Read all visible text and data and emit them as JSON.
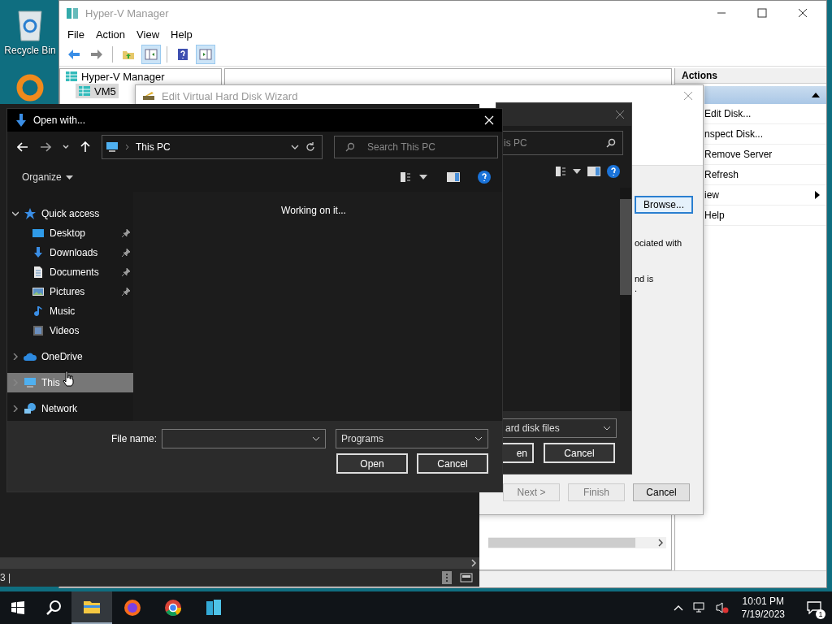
{
  "desktop": {
    "icons": [
      {
        "kind": "recycle",
        "label": "Recycle Bin"
      },
      {
        "kind": "ring"
      }
    ]
  },
  "hyperv": {
    "title": "Hyper-V Manager",
    "menu": [
      "File",
      "Action",
      "View",
      "Help"
    ],
    "toolbar": [
      {
        "kind": "back",
        "pressed": false
      },
      {
        "kind": "forward",
        "pressed": false
      },
      {
        "kind": "folder",
        "pressed": false
      },
      {
        "kind": "tree",
        "pressed": true
      },
      {
        "kind": "help",
        "pressed": false
      },
      {
        "kind": "pane",
        "pressed": true
      }
    ],
    "tree": [
      {
        "label": "Hyper-V Manager",
        "selected": false,
        "children": [
          {
            "label": "VM5",
            "selected": true
          }
        ]
      }
    ],
    "actions": {
      "title": "Actions",
      "items": [
        {
          "label": "Edit Disk...",
          "kind": "action"
        },
        {
          "label": "nspect Disk...",
          "kind": "action"
        },
        {
          "label": "Remove Server",
          "kind": "action"
        },
        {
          "label": "Refresh",
          "kind": "action"
        },
        {
          "label": "iew",
          "kind": "submenu"
        },
        {
          "label": "Help",
          "kind": "action"
        }
      ]
    }
  },
  "wizard": {
    "title": "Edit Virtual Hard Disk Wizard",
    "browse": "Browse...",
    "text": [
      "ociated with",
      "nd is",
      "."
    ],
    "buttons": [
      {
        "label": "Next >",
        "disabled": true
      },
      {
        "label": "Finish",
        "disabled": true
      },
      {
        "label": "Cancel",
        "disabled": false
      }
    ]
  },
  "back_dialog": {
    "search": "is PC",
    "file_type": "ard disk files",
    "buttons": [
      "en",
      "Cancel"
    ]
  },
  "open_dialog": {
    "title": "Open with...",
    "address": "This PC",
    "search_placeholder": "Search This PC",
    "organize": "Organize",
    "status": "Working on it...",
    "nav": [
      {
        "label": "Quick access",
        "kind": "star",
        "expanded": true,
        "selected": false,
        "children": [
          {
            "label": "Desktop",
            "kind": "desktop",
            "pinned": true,
            "selected": false
          },
          {
            "label": "Downloads",
            "kind": "download",
            "pinned": true,
            "selected": false
          },
          {
            "label": "Documents",
            "kind": "document",
            "pinned": true,
            "selected": false
          },
          {
            "label": "Pictures",
            "kind": "picture",
            "pinned": true,
            "selected": false
          },
          {
            "label": "Music",
            "kind": "music",
            "pinned": false,
            "selected": false
          },
          {
            "label": "Videos",
            "kind": "film",
            "pinned": false,
            "selected": false
          }
        ]
      },
      {
        "label": "OneDrive",
        "kind": "cloud",
        "expanded": false,
        "selected": false
      },
      {
        "label": "This",
        "kind": "computer",
        "expanded": false,
        "selected": true
      },
      {
        "label": "Network",
        "kind": "network",
        "expanded": false,
        "selected": false
      }
    ],
    "file_name_label": "File name:",
    "file_type": "Programs",
    "buttons": [
      "Open",
      "Cancel"
    ]
  },
  "console": {
    "status": "3 |"
  },
  "taskbar": {
    "apps": [
      {
        "kind": "explorer",
        "selected": true
      },
      {
        "kind": "firefox",
        "selected": false
      },
      {
        "kind": "chrome",
        "selected": false
      },
      {
        "kind": "hyperv",
        "selected": false
      }
    ],
    "time": "10:01 PM",
    "date": "7/19/2023",
    "notifications": "1"
  }
}
